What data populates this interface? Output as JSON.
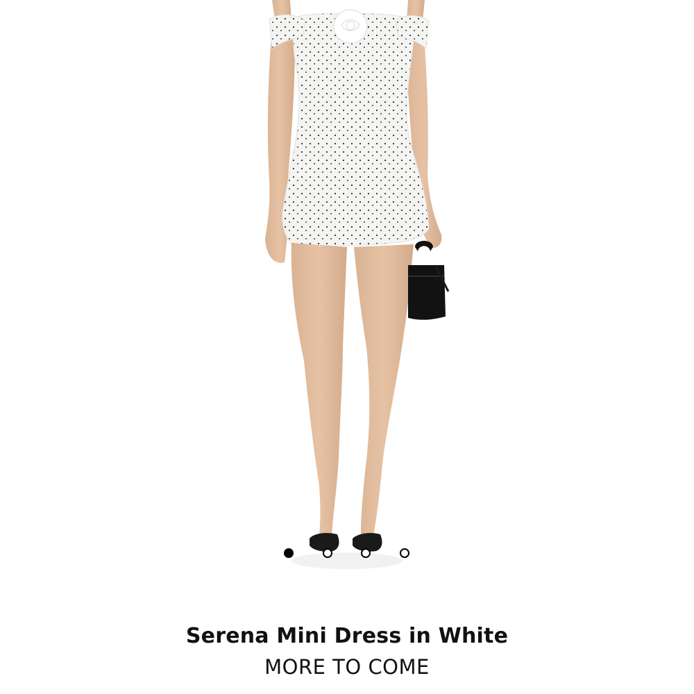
{
  "product": {
    "name": "Serena Mini Dress in White",
    "brand": "MORE TO COME"
  },
  "carousel": {
    "total_images": 4,
    "active_index": 0
  },
  "colors": {
    "background": "#ffffff",
    "text": "#111111",
    "dot_active": "#000000",
    "dot_inactive": "#ffffff"
  }
}
